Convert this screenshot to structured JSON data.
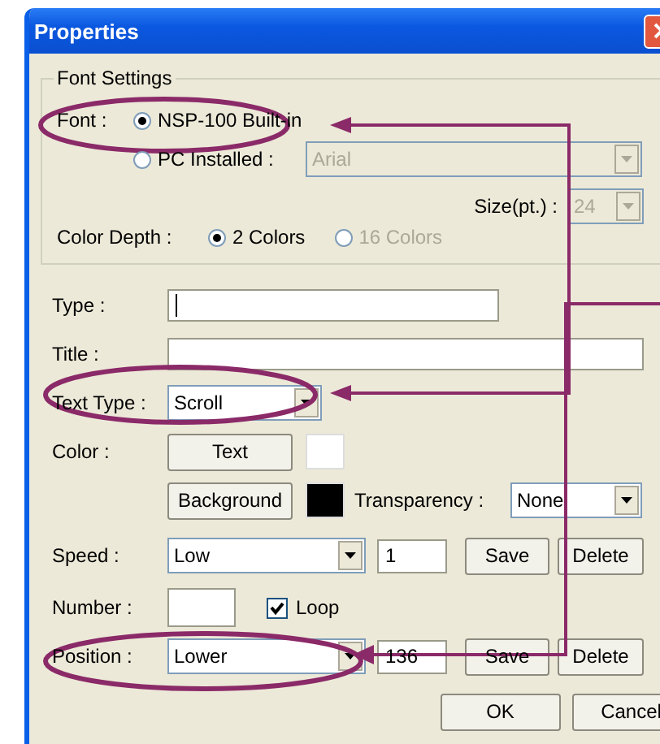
{
  "window": {
    "title": "Properties"
  },
  "font_settings": {
    "title": "Font Settings",
    "font_label": "Font :",
    "options": [
      {
        "label": "NSP-100 Built-in",
        "selected": true
      },
      {
        "label": "PC Installed :",
        "selected": false
      }
    ],
    "pc_font": {
      "value": "Arial",
      "disabled": true
    },
    "size_label": "Size(pt.) :",
    "size": {
      "value": "24",
      "disabled": true
    },
    "color_depth_label": "Color Depth :",
    "color_depths": [
      {
        "label": "2 Colors",
        "selected": true,
        "disabled": false
      },
      {
        "label": "16 Colors",
        "selected": false,
        "disabled": true
      }
    ]
  },
  "type": {
    "label": "Type :"
  },
  "title": {
    "label": "Title :"
  },
  "text_type": {
    "label": "Text Type :",
    "value": "Scroll"
  },
  "color": {
    "label": "Color :",
    "transparency_label": "Transparency :",
    "transparency": "None",
    "swatches": [
      {
        "button": "Text",
        "color": "#ffffff"
      },
      {
        "button": "Background",
        "color": "#000000"
      }
    ]
  },
  "speed": {
    "label": "Speed :",
    "value": "Low",
    "number": "1",
    "buttons": [
      "Save",
      "Delete"
    ]
  },
  "number": {
    "label": "Number :"
  },
  "loop": {
    "label": "Loop",
    "checked": true
  },
  "position": {
    "label": "Position :",
    "value": "Lower",
    "number": "136",
    "buttons": [
      "Save",
      "Delete"
    ]
  },
  "buttons": [
    "OK",
    "Cancel"
  ]
}
